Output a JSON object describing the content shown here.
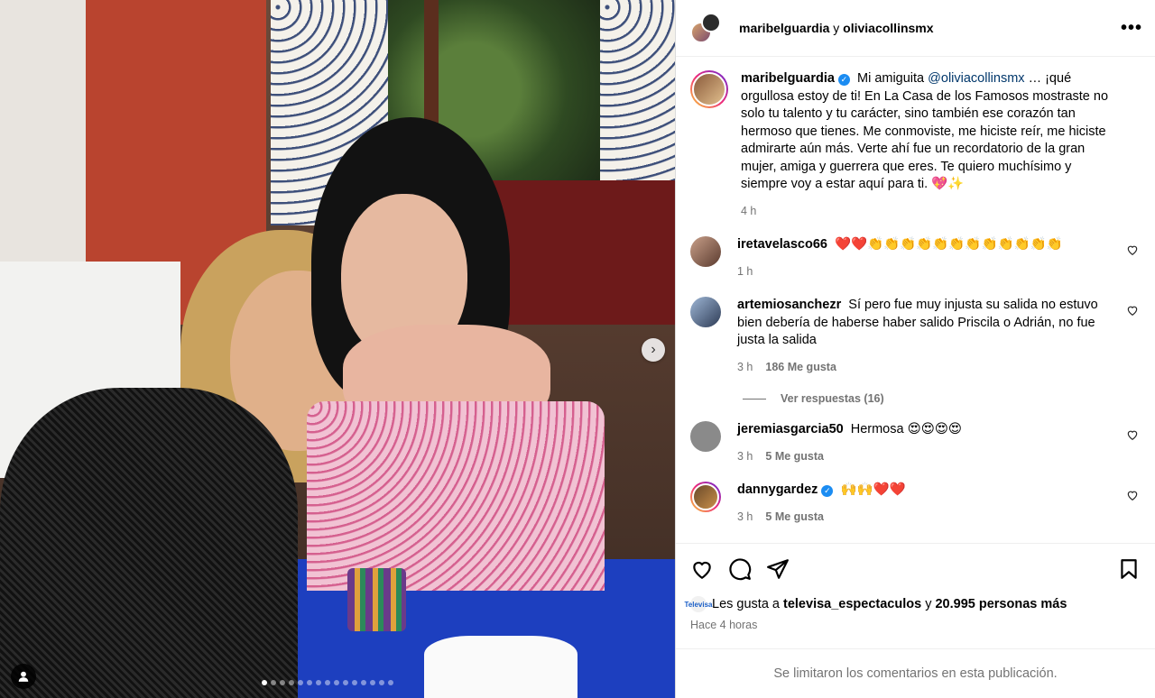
{
  "header": {
    "owner": "maribelguardia",
    "conjunction": "y",
    "collaborator": "oliviacollinsmx",
    "more_label": "•••"
  },
  "caption": {
    "username": "maribelguardia",
    "text_before_mention": "Mi amiguita",
    "mention": "@oliviacollinsmx",
    "text_after_mention": "… ¡qué orgullosa estoy de ti! En La Casa de los Famosos mostraste no solo tu talento y tu carácter, sino también ese corazón tan hermoso que tienes. Me conmoviste, me hiciste reír, me hiciste admirarte aún más. Verte ahí fue un recordatorio de la gran mujer, amiga y guerrera que eres. Te quiero muchísimo y siempre voy a estar aquí para ti. 💖✨",
    "time": "4 h"
  },
  "comments": [
    {
      "username": "iretavelasco66",
      "verified": false,
      "text": "❤️❤️👏👏👏👏👏👏👏👏👏👏👏👏",
      "time": "1 h",
      "likes": ""
    },
    {
      "username": "artemiosanchezr",
      "verified": false,
      "text": "Sí pero fue muy injusta su salida no estuvo bien debería de haberse haber salido Priscila o Adrián, no fue justa la salida",
      "time": "3 h",
      "likes": "186 Me gusta"
    },
    {
      "username": "jeremiasgarcia50",
      "verified": false,
      "text": "Hermosa 😍😍😍😍",
      "time": "3 h",
      "likes": "5 Me gusta"
    },
    {
      "username": "dannygardez",
      "verified": true,
      "text": "🙌🙌❤️❤️",
      "time": "3 h",
      "likes": "5 Me gusta"
    }
  ],
  "replies_label": "Ver respuestas (16)",
  "likes": {
    "prefix": "Les gusta a",
    "user": "televisa_espectaculos",
    "middle": "y",
    "others": "20.995 personas más",
    "mini_avatar_text": "Televisa"
  },
  "time_ago": "Hace 4 horas",
  "comments_limited": "Se limitaron los comentarios en esta publicación.",
  "carousel": {
    "total_slides": 15,
    "active_index": 0
  },
  "colors": {
    "link": "#00376b",
    "verified": "#1b8cf2",
    "muted": "#737373"
  },
  "icons": [
    "chevron-right-icon",
    "user-tag-icon",
    "more-icon",
    "heart-icon",
    "comment-icon",
    "share-icon",
    "bookmark-icon"
  ]
}
